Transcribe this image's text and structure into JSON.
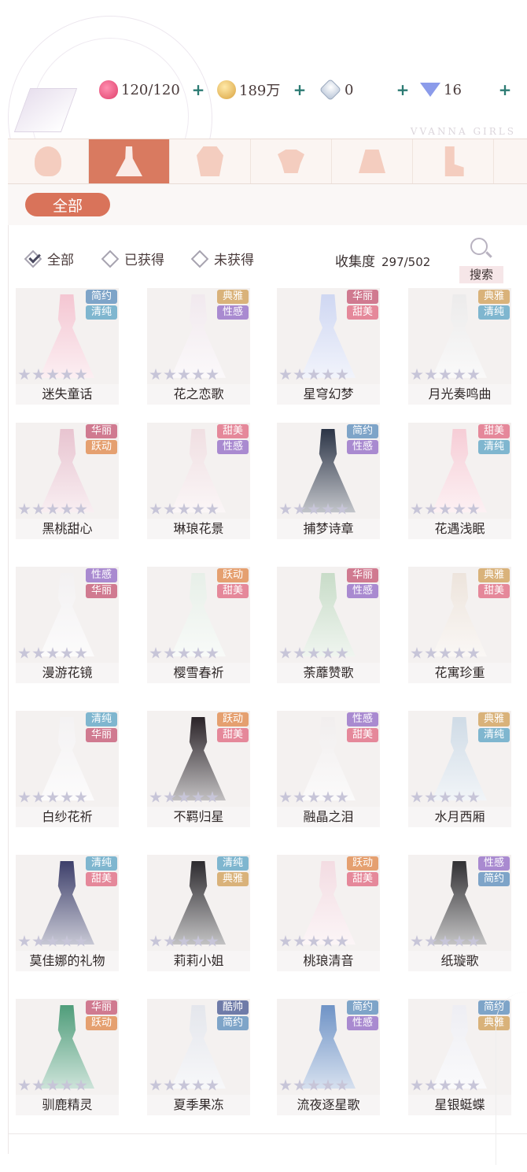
{
  "brand": "VVANNA GIRLS",
  "resources": [
    {
      "icon": "heart-stamina-icon",
      "value": "120/120"
    },
    {
      "icon": "gold-coin-icon",
      "value": "189万"
    },
    {
      "icon": "crystal-icon",
      "value": "0"
    },
    {
      "icon": "diamond-icon",
      "value": "16"
    }
  ],
  "plus_label": "+",
  "category_tabs": [
    {
      "icon": "hair-icon",
      "active": false
    },
    {
      "icon": "dress-icon",
      "active": true
    },
    {
      "icon": "coat-icon",
      "active": false
    },
    {
      "icon": "top-icon",
      "active": false
    },
    {
      "icon": "skirt-icon",
      "active": false
    },
    {
      "icon": "socks-icon",
      "active": false
    }
  ],
  "subtab": "全部",
  "filters": [
    {
      "label": "全部",
      "checked": true
    },
    {
      "label": "已获得",
      "checked": false
    },
    {
      "label": "未获得",
      "checked": false
    }
  ],
  "collection": {
    "label": "收集度",
    "value": "297/502"
  },
  "search_label": "搜索",
  "tag_colors": {
    "清纯": "#7fb6cf",
    "甜美": "#e5889a",
    "性感": "#a98ad0",
    "华丽": "#d07a90",
    "跃动": "#e5a070",
    "简约": "#7ea4c8",
    "典雅": "#d9b27a",
    "酷帅": "#6f7ba8"
  },
  "items": [
    {
      "name": "迷失童话",
      "tags": [
        "简约",
        "清纯"
      ],
      "color": "#f4c6d2"
    },
    {
      "name": "花之恋歌",
      "tags": [
        "典雅",
        "性感"
      ],
      "color": "#f1e9ee"
    },
    {
      "name": "星穹幻梦",
      "tags": [
        "华丽",
        "甜美"
      ],
      "color": "#cfd7f2"
    },
    {
      "name": "月光奏鸣曲",
      "tags": [
        "典雅",
        "清纯"
      ],
      "color": "#ecebeb"
    },
    {
      "name": "黑桃甜心",
      "tags": [
        "华丽",
        "跃动"
      ],
      "color": "#e8c4d0"
    },
    {
      "name": "琳琅花景",
      "tags": [
        "甜美",
        "性感"
      ],
      "color": "#f0dfe2"
    },
    {
      "name": "捕梦诗章",
      "tags": [
        "简约",
        "性感"
      ],
      "color": "#2b3446"
    },
    {
      "name": "花遇浅眠",
      "tags": [
        "甜美",
        "清纯"
      ],
      "color": "#f6cdd6"
    },
    {
      "name": "漫游花镜",
      "tags": [
        "性感",
        "华丽"
      ],
      "color": "#f3f1f2"
    },
    {
      "name": "樱雪春祈",
      "tags": [
        "跃动",
        "甜美"
      ],
      "color": "#e7efe8"
    },
    {
      "name": "荼蘼赞歌",
      "tags": [
        "华丽",
        "性感"
      ],
      "color": "#c8dcc8"
    },
    {
      "name": "花寓珍重",
      "tags": [
        "典雅",
        "甜美"
      ],
      "color": "#ede4dc"
    },
    {
      "name": "白纱花祈",
      "tags": [
        "清纯",
        "华丽"
      ],
      "color": "#f4f2f3"
    },
    {
      "name": "不羁归星",
      "tags": [
        "跃动",
        "甜美"
      ],
      "color": "#2a2328"
    },
    {
      "name": "融晶之泪",
      "tags": [
        "性感",
        "甜美"
      ],
      "color": "#f1eeee"
    },
    {
      "name": "水月西厢",
      "tags": [
        "典雅",
        "清纯"
      ],
      "color": "#cfdbe6"
    },
    {
      "name": "莫佳娜的礼物",
      "tags": [
        "清纯",
        "甜美"
      ],
      "color": "#3d3f6a"
    },
    {
      "name": "莉莉小姐",
      "tags": [
        "清纯",
        "典雅"
      ],
      "color": "#2c2a2e"
    },
    {
      "name": "桃琅清音",
      "tags": [
        "跃动",
        "甜美"
      ],
      "color": "#f3dce2"
    },
    {
      "name": "纸璇歌",
      "tags": [
        "性感",
        "简约"
      ],
      "color": "#313033"
    },
    {
      "name": "驯鹿精灵",
      "tags": [
        "华丽",
        "跃动"
      ],
      "color": "#4f9d7a"
    },
    {
      "name": "夏季果冻",
      "tags": [
        "酷帅",
        "简约"
      ],
      "color": "#e4e6ec"
    },
    {
      "name": "流夜逐星歌",
      "tags": [
        "简约",
        "性感"
      ],
      "color": "#6f93c6"
    },
    {
      "name": "星银蜓蝶",
      "tags": [
        "简约",
        "典雅"
      ],
      "color": "#eeeef3"
    }
  ]
}
